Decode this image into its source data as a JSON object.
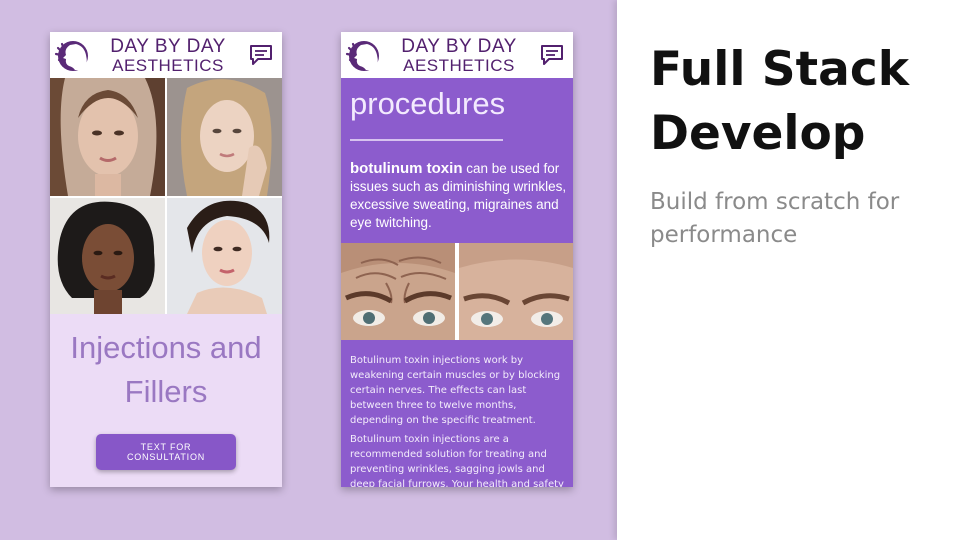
{
  "slide": {
    "heading": "Full Stack Develop",
    "subheading": "Build from scratch for performance",
    "colors": {
      "left_background": "#d1bde2",
      "accent_purple": "#8c5ccd",
      "light_lavender": "#ecdcf6",
      "brand_dark": "#52206e"
    }
  },
  "brand": {
    "line1": "DAY BY DAY",
    "line2": "AESTHETICS",
    "logo_icon": "face-silhouette-logo",
    "message_icon": "chat-bubble-icon"
  },
  "phone1": {
    "title": "Injections and Fillers",
    "button_label": "TEXT FOR CONSULTATION"
  },
  "phone2": {
    "title": "procedures",
    "lead_bold": "botulinum toxin",
    "lead_rest": " can be used for issues such as diminishing wrinkles, excessive sweating, migraines and eye twitching.",
    "paragraph1": "Botulinum toxin injections work by weakening certain muscles or by blocking certain nerves. The effects can last between three to twelve months, depending on the specific treatment.",
    "paragraph2": "Botulinum toxin injections are a recommended solution for treating and preventing wrinkles, sagging jowls and deep facial furrows. Your health and safety are top"
  }
}
